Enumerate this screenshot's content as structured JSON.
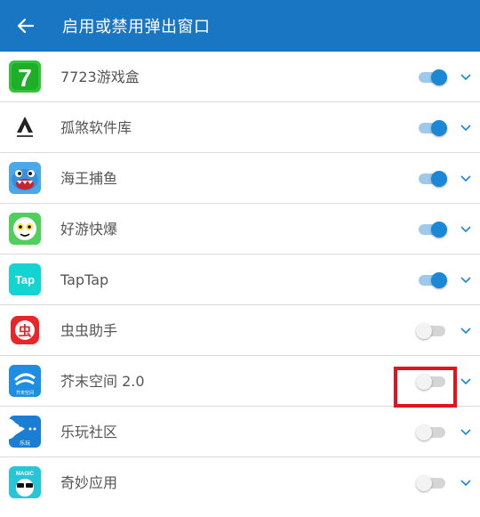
{
  "header": {
    "title": "启用或禁用弹出窗口",
    "background": "#1976c2"
  },
  "apps": [
    {
      "name": "7723游戏盒",
      "enabled": true,
      "icon": "7723-app-icon"
    },
    {
      "name": "孤煞软件库",
      "enabled": true,
      "icon": "gusha-app-icon"
    },
    {
      "name": "海王捕鱼",
      "enabled": true,
      "icon": "shark-app-icon"
    },
    {
      "name": "好游快爆",
      "enabled": true,
      "icon": "haoyou-app-icon"
    },
    {
      "name": "TapTap",
      "enabled": true,
      "icon": "taptap-app-icon"
    },
    {
      "name": "虫虫助手",
      "enabled": false,
      "icon": "chongchong-app-icon"
    },
    {
      "name": "芥末空间 2.0",
      "enabled": false,
      "icon": "jiemo-app-icon"
    },
    {
      "name": "乐玩社区",
      "enabled": false,
      "icon": "lewan-app-icon"
    },
    {
      "name": "奇妙应用",
      "enabled": false,
      "icon": "qimiao-app-icon"
    }
  ],
  "icon_text": {
    "taptap": "Tap",
    "chongchong": "虫",
    "lewan": "乐玩",
    "jiemo": "芥末空间",
    "qimiao": "MAGIC",
    "seven": "7"
  },
  "colors": {
    "accent": "#1a88d6",
    "highlight": "#e0141e"
  }
}
